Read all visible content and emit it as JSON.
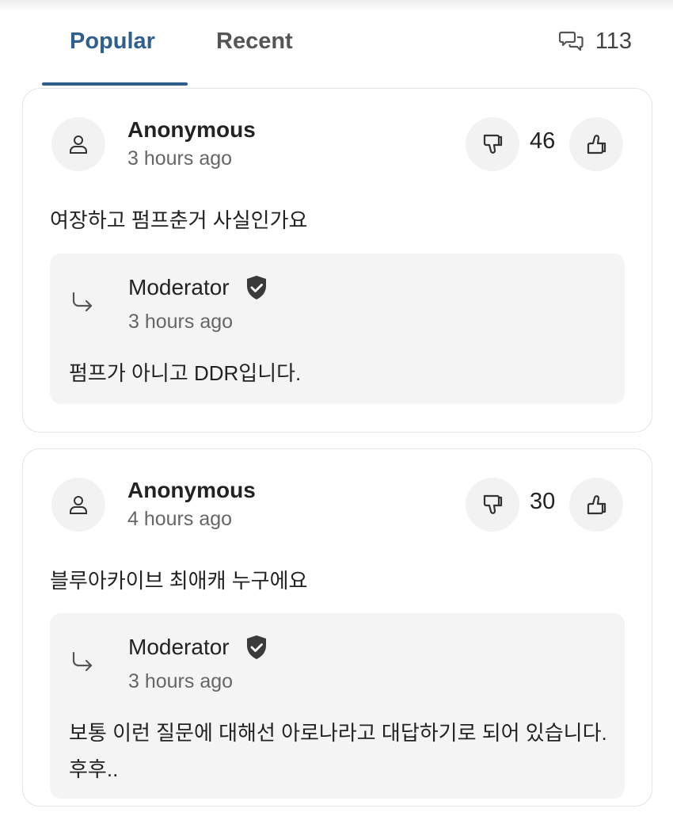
{
  "tabs": {
    "popular": "Popular",
    "recent": "Recent",
    "active": "Popular",
    "comment_count": "113",
    "comment_icon": "speech-bubbles-icon"
  },
  "colors": {
    "accent": "#2f5f8a",
    "card_border": "#e3e3e3",
    "reply_bg": "#f4f4f5",
    "icon_bg": "#f2f2f2"
  },
  "comments": [
    {
      "author": "Anonymous",
      "time": "3 hours ago",
      "votes": "46",
      "text": "여장하고 펌프춘거 사실인가요",
      "reply": {
        "author": "Moderator",
        "time": "3 hours ago",
        "text": "펌프가 아니고 DDR입니다."
      }
    },
    {
      "author": "Anonymous",
      "time": "4 hours ago",
      "votes": "30",
      "text": "블루아카이브 최애캐 누구에요",
      "reply": {
        "author": "Moderator",
        "time": "3 hours ago",
        "text": "보통 이런 질문에 대해선 아로나라고 대답하기로 되어 있습니다. 후후.."
      }
    }
  ]
}
